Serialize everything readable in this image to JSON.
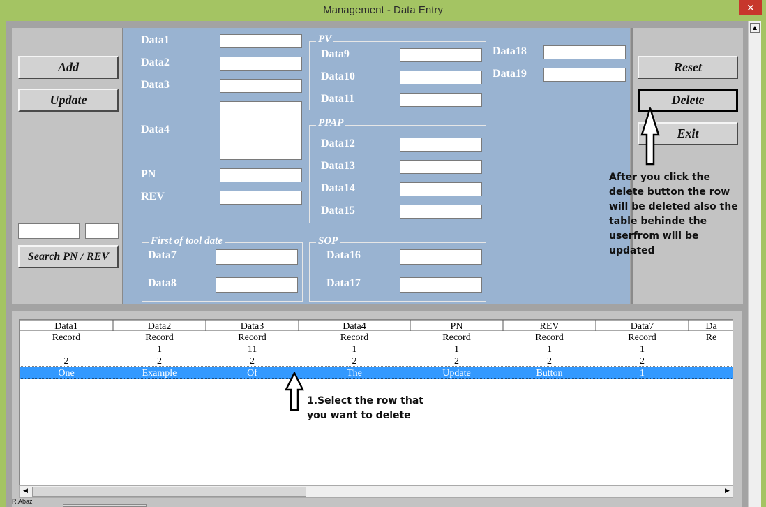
{
  "window": {
    "title": "Management - Data Entry",
    "close_glyph": "✕",
    "scroll_up_glyph": "▲"
  },
  "left_panel": {
    "add_label": "Add",
    "update_label": "Update",
    "search_pn_value": "",
    "search_rev_value": "",
    "search_label": "Search PN / REV"
  },
  "form": {
    "data1": {
      "label": "Data1",
      "value": ""
    },
    "data2": {
      "label": "Data2",
      "value": ""
    },
    "data3": {
      "label": "Data3",
      "value": ""
    },
    "data4": {
      "label": "Data4",
      "value": ""
    },
    "pn": {
      "label": "PN",
      "value": ""
    },
    "rev": {
      "label": "REV",
      "value": ""
    },
    "group_pv": "PV",
    "data9": {
      "label": "Data9",
      "value": ""
    },
    "data10": {
      "label": "Data10",
      "value": ""
    },
    "data11": {
      "label": "Data11",
      "value": ""
    },
    "group_ppap": "PPAP",
    "data12": {
      "label": "Data12",
      "value": ""
    },
    "data13": {
      "label": "Data13",
      "value": ""
    },
    "data14": {
      "label": "Data14",
      "value": ""
    },
    "data15": {
      "label": "Data15",
      "value": ""
    },
    "group_first_tool": "First of tool date",
    "data7": {
      "label": "Data7",
      "value": ""
    },
    "data8": {
      "label": "Data8",
      "value": ""
    },
    "group_sop": "SOP",
    "data16": {
      "label": "Data16",
      "value": ""
    },
    "data17": {
      "label": "Data17",
      "value": ""
    },
    "data18": {
      "label": "Data18",
      "value": ""
    },
    "data19": {
      "label": "Data19",
      "value": ""
    }
  },
  "right_panel": {
    "reset_label": "Reset",
    "delete_label": "Delete",
    "exit_label": "Exit"
  },
  "annotations": {
    "delete_note": [
      "After you click the",
      "delete button the row",
      "will be deleted also the",
      "table behinde the",
      "userfrom will be",
      "updated"
    ],
    "select_note": [
      "1.Select the row that",
      "you want to delete"
    ]
  },
  "table": {
    "columns": [
      "Data1",
      "Data2",
      "Data3",
      "Data4",
      "PN",
      "REV",
      "Data7",
      "Da"
    ],
    "rows": [
      [
        "Record",
        "Record",
        "Record",
        "Record",
        "Record",
        "Record",
        "Record",
        "Re"
      ],
      [
        "",
        "1",
        "11",
        "1",
        "1",
        "1",
        "1",
        ""
      ],
      [
        "2",
        "2",
        "2",
        "2",
        "2",
        "2",
        "2",
        ""
      ],
      [
        "One",
        "Example",
        "Of",
        "The",
        "Update",
        "Button",
        "1",
        ""
      ]
    ],
    "selected_row": 3
  },
  "scrollbar": {
    "left_glyph": "◀",
    "right_glyph": "▶"
  },
  "status": {
    "author": "R.Abazi"
  },
  "colors": {
    "titlebar": "#a4c463",
    "form_panel": "#99b3d1",
    "selection": "#3399ff",
    "close": "#c7372c"
  }
}
